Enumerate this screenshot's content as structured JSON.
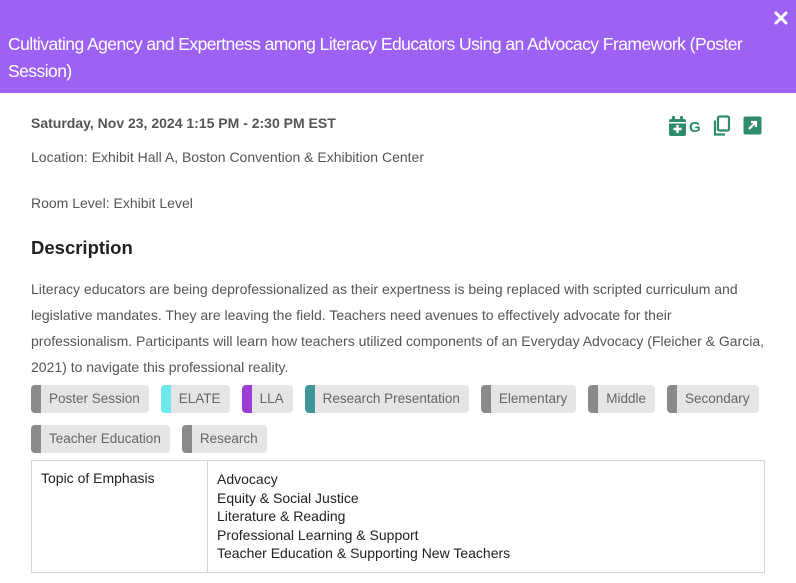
{
  "header": {
    "title": "Cultivating Agency and Expertness among Literacy Educators Using an Advocacy Framework (Poster Session)",
    "background": "#9d62f4",
    "close_icon": "close-icon"
  },
  "session": {
    "datetime": "Saturday, Nov 23, 2024 1:15 PM - 2:30 PM EST",
    "location": "Location: Exhibit Hall A, Boston Convention & Exhibition Center",
    "room_level": "Room Level: Exhibit Level"
  },
  "actions": {
    "accent": "#2e8b6e",
    "add_google_calendar_icon": "calendar-plus-icon",
    "google_label": "G",
    "copy_icon": "copy-icon",
    "open_icon": "open-external-icon"
  },
  "description": {
    "heading": "Description",
    "text": "Literacy educators are being deprofessionalized as their expertness is being replaced with scripted curriculum and legislative mandates. They are leaving the field. Teachers need avenues to effectively advocate for their professionalism. Participants will learn how teachers utilized components of an Everyday Advocacy (Fleicher & Garcia, 2021) to navigate this professional reality."
  },
  "tags": [
    {
      "label": "Poster Session",
      "color": "#8a8a8a"
    },
    {
      "label": "ELATE",
      "color": "#6ee8ef"
    },
    {
      "label": "LLA",
      "color": "#9b3cd6"
    },
    {
      "label": "Research Presentation",
      "color": "#3f9696"
    },
    {
      "label": "Elementary",
      "color": "#8a8a8a"
    },
    {
      "label": "Middle",
      "color": "#8a8a8a"
    },
    {
      "label": "Secondary",
      "color": "#8a8a8a"
    },
    {
      "label": "Teacher Education",
      "color": "#8a8a8a"
    },
    {
      "label": "Research",
      "color": "#8a8a8a"
    }
  ],
  "topics": {
    "label": "Topic of Emphasis",
    "items": [
      "Advocacy",
      "Equity & Social Justice",
      "Literature & Reading",
      "Professional Learning & Support",
      "Teacher Education & Supporting New Teachers"
    ]
  }
}
